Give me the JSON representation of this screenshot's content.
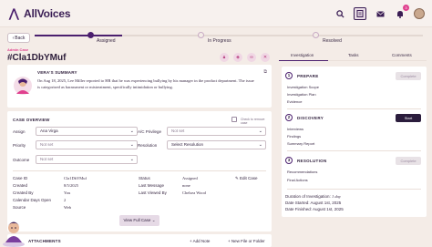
{
  "brand": {
    "name": "AllVoices"
  },
  "top_icons": [
    "search-icon",
    "document-icon",
    "mail-icon",
    "bell-icon",
    "avatar"
  ],
  "notifications": {
    "count": "3"
  },
  "nav": {
    "back_label": "Back"
  },
  "progress": {
    "steps": [
      {
        "label": "Assigned",
        "state": "done"
      },
      {
        "label": "In Progress",
        "state": "todo"
      },
      {
        "label": "Resolved",
        "state": "todo"
      }
    ]
  },
  "case": {
    "type_label": "Admin Case",
    "id": "#Cla1DbYMuf"
  },
  "vera": {
    "title": "VERA'S SUMMARY",
    "text": "On Aug 18, 2025, Lee Miller reported to HR that he was experiencing bullying by his manager in the product department. The issue is categorized as harassment or mistreatment, specifically intimidation or bullying."
  },
  "overview": {
    "title": "CASE OVERVIEW",
    "remove_label": "Check to remove case",
    "fields": {
      "assign": {
        "label": "Assign",
        "value": "Ana Virga"
      },
      "privilege": {
        "label": "A/C Privilege",
        "value": "Not set"
      },
      "priority": {
        "label": "Priority",
        "value": "Not set"
      },
      "resolution": {
        "label": "Resolution",
        "value": "Select Resolution"
      },
      "outcome": {
        "label": "Outcome",
        "value": "Not set"
      }
    },
    "meta_left": [
      {
        "label": "Case ID",
        "value": "Cla1DbYMuf"
      },
      {
        "label": "Created",
        "value": "8/5/2025"
      },
      {
        "label": "Created By",
        "value": "You"
      },
      {
        "label": "Calendar Days Open",
        "value": "2"
      },
      {
        "label": "Source",
        "value": "Web"
      }
    ],
    "meta_right": [
      {
        "label": "Status",
        "value": "Assigned"
      },
      {
        "label": "Last Message",
        "value": "none"
      },
      {
        "label": "Last Viewed By",
        "value": "Chelsea Wood"
      }
    ],
    "edit_label": "Edit Case",
    "view_full_label": "View Full Case"
  },
  "attachments": {
    "title": "ATTACHMENTS",
    "add_note": "Add Note",
    "add_file": "New File or Folder"
  },
  "side_tabs": [
    {
      "label": "Investigation",
      "active": true
    },
    {
      "label": "Tasks",
      "active": false
    },
    {
      "label": "Comments",
      "active": false
    }
  ],
  "phases": [
    {
      "num": "1",
      "title": "PREPARE",
      "button": "Complete",
      "button_state": "disabled",
      "items": [
        "Investigation Scope",
        "Investigation Plan",
        "Evidence"
      ]
    },
    {
      "num": "2",
      "title": "DISCOVERY",
      "button": "Start",
      "button_state": "active",
      "items": [
        "Interviews",
        "Findings",
        "Summary Report"
      ]
    },
    {
      "num": "3",
      "title": "RESOLUTION",
      "button": "Complete",
      "button_state": "disabled",
      "items": [
        "Recommendations",
        "Final Actions"
      ]
    }
  ],
  "duration": {
    "label": "Duration of Investigation:",
    "value": "1 day",
    "started_label": "Date Started:",
    "started": "August 1st, 2025",
    "finished_label": "Date Finished:",
    "finished": "August 1st, 2025"
  },
  "colors": {
    "accent": "#4b1f6e",
    "pink": "#e0408e",
    "background": "#f4ece7",
    "dark_button": "#2b1d3d"
  }
}
